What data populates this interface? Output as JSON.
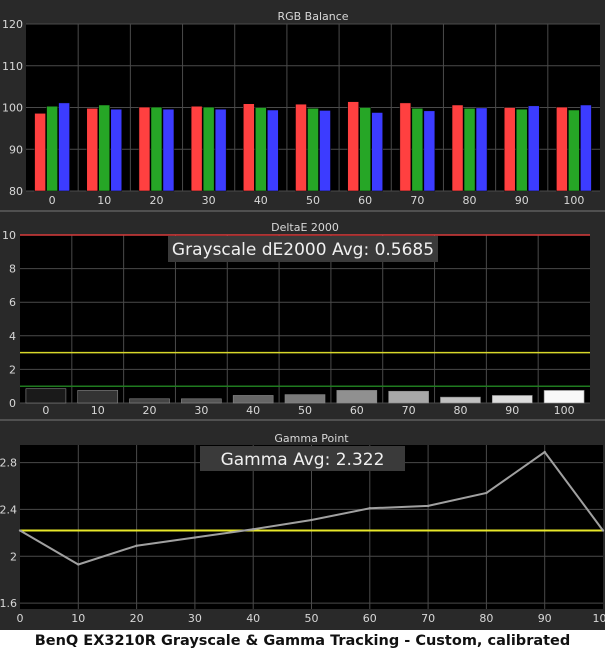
{
  "caption": "BenQ EX3210R Grayscale & Gamma Tracking - Custom, calibrated",
  "colors": {
    "background": "#292929",
    "plot": "#000000",
    "grid": "#4a4a4a",
    "text": "#d8d8d8",
    "red": "#ff4040",
    "green": "#26a626",
    "blue": "#3c3cff",
    "threshold_red": "#d83a3a",
    "threshold_yellow": "#d7d72a",
    "threshold_green": "#1f7a1f",
    "gamma_target": "#e8e82a",
    "gamma_line": "#a0a0a0",
    "label_box": "#3a3a3a"
  },
  "chart_data": [
    {
      "type": "bar",
      "title": "RGB Balance",
      "categories": [
        "0",
        "10",
        "20",
        "30",
        "40",
        "50",
        "60",
        "70",
        "80",
        "90",
        "100"
      ],
      "ylim": [
        80,
        120
      ],
      "yticks": [
        80,
        90,
        100,
        110,
        120
      ],
      "grid": true,
      "series": [
        {
          "color_key": "red",
          "values": [
            98.6,
            99.8,
            100.1,
            100.3,
            100.9,
            100.8,
            101.4,
            101.1,
            100.6,
            100.0,
            100.1
          ]
        },
        {
          "color_key": "green",
          "values": [
            100.3,
            100.6,
            100.1,
            100.1,
            100.0,
            99.8,
            100.0,
            99.8,
            99.8,
            99.6,
            99.4
          ]
        },
        {
          "color_key": "blue",
          "values": [
            101.1,
            99.6,
            99.6,
            99.6,
            99.4,
            99.3,
            98.8,
            99.2,
            99.9,
            100.4,
            100.6
          ]
        }
      ]
    },
    {
      "type": "bar",
      "title": "DeltaE 2000",
      "annotation": "Grayscale dE2000 Avg: 0.5685",
      "categories": [
        "0",
        "10",
        "20",
        "30",
        "40",
        "50",
        "60",
        "70",
        "80",
        "90",
        "100"
      ],
      "ylim": [
        0,
        10
      ],
      "yticks": [
        0,
        2,
        4,
        6,
        8,
        10
      ],
      "thresholds": [
        {
          "value": 10,
          "color_key": "threshold_red"
        },
        {
          "value": 3,
          "color_key": "threshold_yellow"
        },
        {
          "value": 1,
          "color_key": "threshold_green"
        }
      ],
      "values": [
        0.85,
        0.75,
        0.25,
        0.25,
        0.45,
        0.5,
        0.75,
        0.7,
        0.35,
        0.45,
        0.75
      ],
      "bar_shades": [
        "#1a1a1a",
        "#333333",
        "#444444",
        "#555555",
        "#666666",
        "#7a7a7a",
        "#909090",
        "#a8a8a8",
        "#c0c0c0",
        "#dcdcdc",
        "#f8f8f8"
      ]
    },
    {
      "type": "line",
      "title": "Gamma Point",
      "annotation": "Gamma Avg: 2.322",
      "x": [
        0,
        10,
        20,
        30,
        40,
        50,
        60,
        70,
        80,
        90,
        100
      ],
      "y": [
        2.22,
        1.93,
        2.09,
        2.16,
        2.23,
        2.31,
        2.41,
        2.43,
        2.54,
        2.89,
        2.22
      ],
      "target": 2.22,
      "xlim": [
        0,
        100
      ],
      "ylim": [
        1.55,
        2.95
      ],
      "xticks": [
        0,
        10,
        20,
        30,
        40,
        50,
        60,
        70,
        80,
        90,
        100
      ],
      "yticks": [
        1.6,
        2,
        2.4,
        2.8
      ],
      "ytick_labels": [
        "1.6",
        "2",
        "2.4",
        "2.8"
      ]
    }
  ]
}
